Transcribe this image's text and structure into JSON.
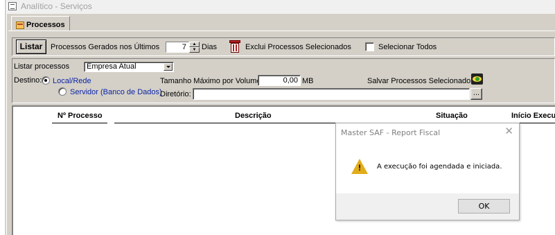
{
  "window": {
    "title": "Analítico - Serviços"
  },
  "tabs": [
    {
      "label": "Processos"
    }
  ],
  "toolbar": {
    "listar_label": "Listar",
    "generated_label": "Processos Gerados nos Últimos",
    "days_value": "7",
    "days_label": "Dias",
    "delete_label": "Exclui Processos Selecionados",
    "select_all_label": "Selecionar Todos",
    "select_all_checked": false
  },
  "options": {
    "list_label": "Listar processos",
    "list_value": "Empresa Atual",
    "destino_label": "Destino:",
    "radio_local": "Local/Rede",
    "radio_server": "Servidor (Banco de Dados)",
    "selected_destination": "Local/Rede",
    "max_size_label": "Tamanho Máximo por Volume:",
    "max_size_value": "0,00",
    "max_size_unit": "MB",
    "save_label": "Salvar Processos Selecionados",
    "dir_label": "Diretório:",
    "dir_value": "",
    "browse_label": "..."
  },
  "grid": {
    "columns": [
      "Nº Processo",
      "Descrição",
      "Situação",
      "Início Execução"
    ],
    "rows": []
  },
  "dialog": {
    "title": "Master SAF - Report Fiscal",
    "close_glyph": "✕",
    "icon": "warning-icon",
    "message": "A execução foi agendada e iniciada.",
    "ok_label": "OK"
  }
}
